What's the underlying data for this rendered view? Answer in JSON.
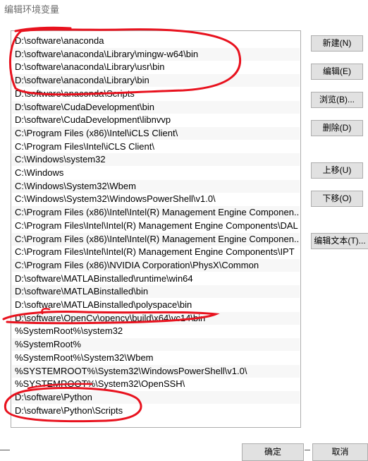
{
  "window": {
    "title": "编辑环境变量"
  },
  "list": {
    "items": [
      "D:\\software\\anaconda",
      "D:\\software\\anaconda\\Library\\mingw-w64\\bin",
      "D:\\software\\anaconda\\Library\\usr\\bin",
      "D:\\software\\anaconda\\Library\\bin",
      "D:\\software\\anaconda\\Scripts",
      "D:\\software\\CudaDevelopment\\bin",
      "D:\\software\\CudaDevelopment\\libnvvp",
      "C:\\Program Files (x86)\\Intel\\iCLS Client\\",
      "C:\\Program Files\\Intel\\iCLS Client\\",
      "C:\\Windows\\system32",
      "C:\\Windows",
      "C:\\Windows\\System32\\Wbem",
      "C:\\Windows\\System32\\WindowsPowerShell\\v1.0\\",
      "C:\\Program Files (x86)\\Intel\\Intel(R) Management Engine Componen...",
      "C:\\Program Files\\Intel\\Intel(R) Management Engine Components\\DAL",
      "C:\\Program Files (x86)\\Intel\\Intel(R) Management Engine Componen...",
      "C:\\Program Files\\Intel\\Intel(R) Management Engine Components\\IPT",
      "C:\\Program Files (x86)\\NVIDIA Corporation\\PhysX\\Common",
      "D:\\software\\MATLABinstalled\\runtime\\win64",
      "D:\\software\\MATLABinstalled\\bin",
      "D:\\software\\MATLABinstalled\\polyspace\\bin",
      "D:\\software\\OpenCv\\opencv\\build\\x64\\vc14\\bin",
      "%SystemRoot%\\system32",
      "%SystemRoot%",
      "%SystemRoot%\\System32\\Wbem",
      "%SYSTEMROOT%\\System32\\WindowsPowerShell\\v1.0\\",
      "%SYSTEMROOT%\\System32\\OpenSSH\\",
      "D:\\software\\Python",
      "D:\\software\\Python\\Scripts"
    ]
  },
  "buttons": {
    "new": "新建(N)",
    "edit": "编辑(E)",
    "browse": "浏览(B)...",
    "delete": "删除(D)",
    "move_up": "上移(U)",
    "move_down": "下移(O)",
    "edit_text": "编辑文本(T)..."
  },
  "footer": {
    "ok": "确定",
    "cancel": "取消"
  },
  "colors": {
    "annotation": "#e8121e",
    "button_bg": "#e1e1e1",
    "row_alt": "#f7f7f7"
  }
}
